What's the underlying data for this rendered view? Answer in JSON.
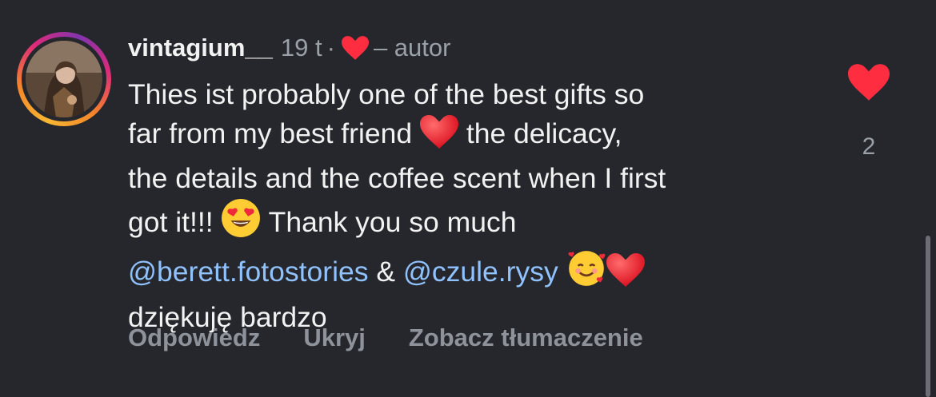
{
  "comment": {
    "username": "vintagium__",
    "time": "19 t",
    "separator": "·",
    "author_tag": "– autor",
    "like_count": "2",
    "text": {
      "l1": "Thies ist probably one of the best gifts so",
      "l2a": "far from my best friend ",
      "l2b": " the delicacy,",
      "l3": "the details and the coffee scent when I first",
      "l4a": "got it!!! ",
      "l4b": " Thank you so much",
      "mention1": "@berett.fotostories",
      "amp": " & ",
      "mention2": "@czule.rysy",
      "l6": "dziękuję bardzo"
    },
    "actions": {
      "reply": "Odpowiedz",
      "hide": "Ukryj",
      "translate": "Zobacz tłumaczenie"
    }
  },
  "colors": {
    "background": "#25272c",
    "text": "#f2f2f2",
    "muted": "#9aa0a8",
    "mention": "#8fc2ff",
    "heart": "#ff2d3f"
  },
  "icons": {
    "author_like": "heart-icon",
    "like_button": "heart-icon",
    "emojis": [
      "red-heart-emoji",
      "heart-eyes-emoji",
      "smiling-face-with-hearts-emoji",
      "red-heart-emoji"
    ]
  }
}
